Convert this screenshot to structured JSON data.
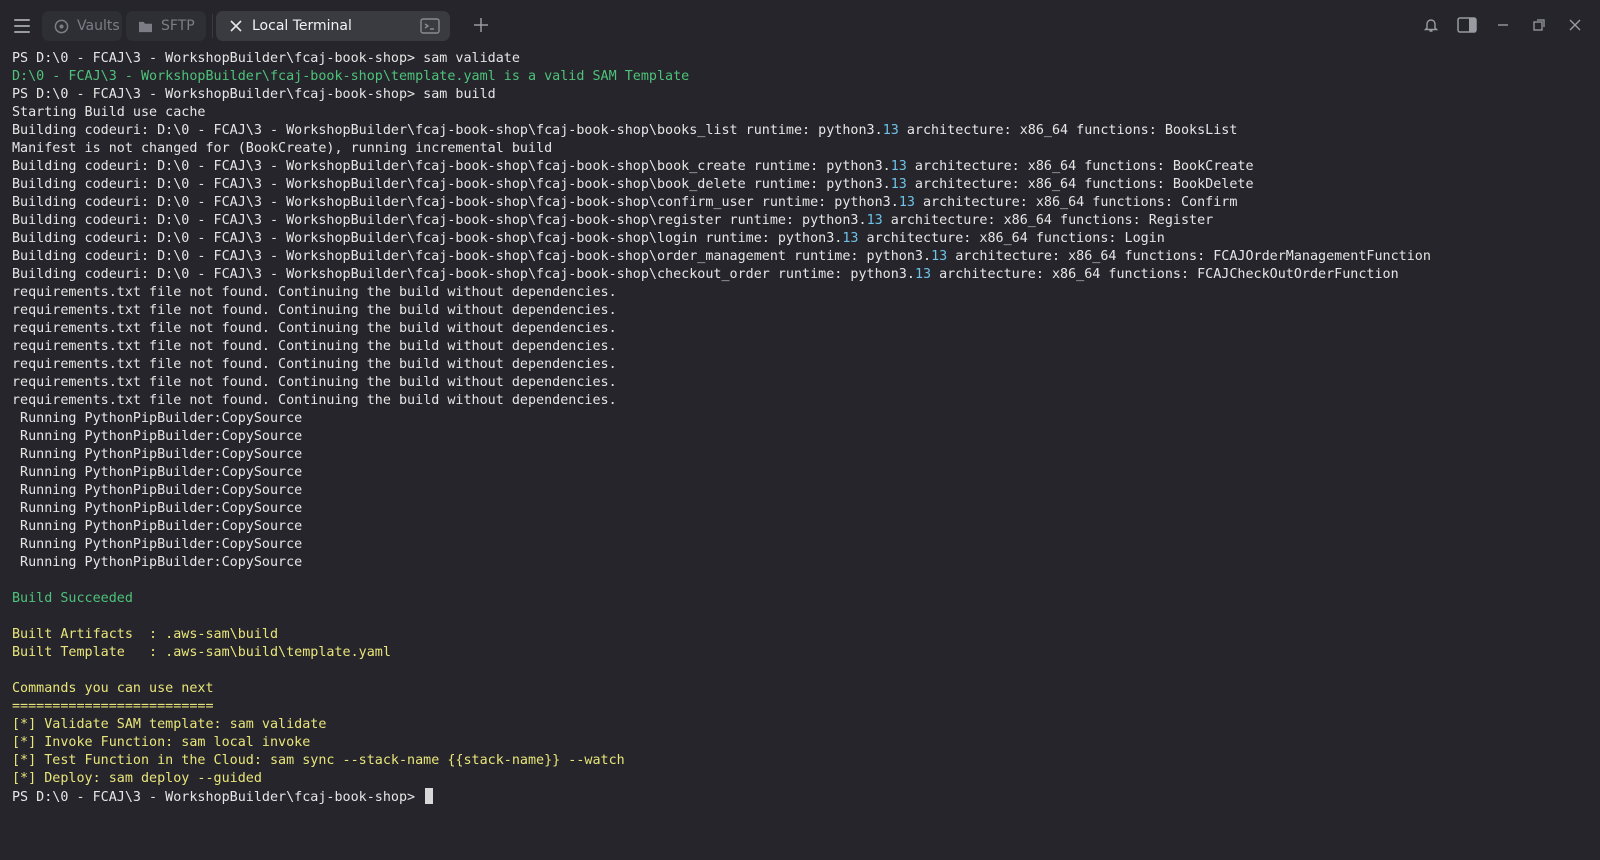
{
  "colors": {
    "background": "#25252b",
    "text": "#e6e6e6",
    "success_green": "#4ec27a",
    "hint_yellow": "#e9e57a",
    "number_blue": "#6fc2e8",
    "tab_active_bg": "#3a3a41"
  },
  "titlebar": {
    "tabs": [
      {
        "label": "Vaults",
        "icon": "vault-icon",
        "active": false
      },
      {
        "label": "SFTP",
        "icon": "folder-icon",
        "active": false
      },
      {
        "label": "Local Terminal",
        "icon": "close-icon",
        "active": true,
        "action_icon": "terminal-icon"
      }
    ],
    "new_tab_icon": "plus-icon",
    "controls": [
      "notification-bell-icon",
      "split-panel-icon",
      "minimize-icon",
      "restore-icon",
      "close-icon"
    ]
  },
  "terminal": {
    "lines": [
      [
        {
          "t": "PS D:\\0 - FCAJ\\3 - WorkshopBuilder\\fcaj-book-shop> sam validate"
        }
      ],
      [
        {
          "t": "D:\\0 - FCAJ\\3 - WorkshopBuilder\\fcaj-book-shop\\template.yaml is a valid SAM Template",
          "c": "green"
        }
      ],
      [
        {
          "t": "PS D:\\0 - FCAJ\\3 - WorkshopBuilder\\fcaj-book-shop> sam build"
        }
      ],
      [
        {
          "t": "Starting Build use cache"
        }
      ],
      [
        {
          "t": "Building codeuri: D:\\0 - FCAJ\\3 - WorkshopBuilder\\fcaj-book-shop\\fcaj-book-shop\\books_list runtime: python3."
        },
        {
          "t": "13",
          "c": "num"
        },
        {
          "t": " architecture: x86_64 functions: BooksList"
        }
      ],
      [
        {
          "t": "Manifest is not changed for (BookCreate), running incremental build"
        }
      ],
      [
        {
          "t": "Building codeuri: D:\\0 - FCAJ\\3 - WorkshopBuilder\\fcaj-book-shop\\fcaj-book-shop\\book_create runtime: python3."
        },
        {
          "t": "13",
          "c": "num"
        },
        {
          "t": " architecture: x86_64 functions: BookCreate"
        }
      ],
      [
        {
          "t": "Building codeuri: D:\\0 - FCAJ\\3 - WorkshopBuilder\\fcaj-book-shop\\fcaj-book-shop\\book_delete runtime: python3."
        },
        {
          "t": "13",
          "c": "num"
        },
        {
          "t": " architecture: x86_64 functions: BookDelete"
        }
      ],
      [
        {
          "t": "Building codeuri: D:\\0 - FCAJ\\3 - WorkshopBuilder\\fcaj-book-shop\\fcaj-book-shop\\confirm_user runtime: python3."
        },
        {
          "t": "13",
          "c": "num"
        },
        {
          "t": " architecture: x86_64 functions: Confirm"
        }
      ],
      [
        {
          "t": "Building codeuri: D:\\0 - FCAJ\\3 - WorkshopBuilder\\fcaj-book-shop\\fcaj-book-shop\\register runtime: python3."
        },
        {
          "t": "13",
          "c": "num"
        },
        {
          "t": " architecture: x86_64 functions: Register"
        }
      ],
      [
        {
          "t": "Building codeuri: D:\\0 - FCAJ\\3 - WorkshopBuilder\\fcaj-book-shop\\fcaj-book-shop\\login runtime: python3."
        },
        {
          "t": "13",
          "c": "num"
        },
        {
          "t": " architecture: x86_64 functions: Login"
        }
      ],
      [
        {
          "t": "Building codeuri: D:\\0 - FCAJ\\3 - WorkshopBuilder\\fcaj-book-shop\\fcaj-book-shop\\order_management runtime: python3."
        },
        {
          "t": "13",
          "c": "num"
        },
        {
          "t": " architecture: x86_64 functions: FCAJOrderManagementFunction"
        }
      ],
      [
        {
          "t": "Building codeuri: D:\\0 - FCAJ\\3 - WorkshopBuilder\\fcaj-book-shop\\fcaj-book-shop\\checkout_order runtime: python3."
        },
        {
          "t": "13",
          "c": "num"
        },
        {
          "t": " architecture: x86_64 functions: FCAJCheckOutOrderFunction"
        }
      ],
      [
        {
          "t": "requirements.txt file not found. Continuing the build without dependencies."
        }
      ],
      [
        {
          "t": "requirements.txt file not found. Continuing the build without dependencies."
        }
      ],
      [
        {
          "t": "requirements.txt file not found. Continuing the build without dependencies."
        }
      ],
      [
        {
          "t": "requirements.txt file not found. Continuing the build without dependencies."
        }
      ],
      [
        {
          "t": "requirements.txt file not found. Continuing the build without dependencies."
        }
      ],
      [
        {
          "t": "requirements.txt file not found. Continuing the build without dependencies."
        }
      ],
      [
        {
          "t": "requirements.txt file not found. Continuing the build without dependencies."
        }
      ],
      [
        {
          "t": " Running PythonPipBuilder:CopySource"
        }
      ],
      [
        {
          "t": " Running PythonPipBuilder:CopySource"
        }
      ],
      [
        {
          "t": " Running PythonPipBuilder:CopySource"
        }
      ],
      [
        {
          "t": " Running PythonPipBuilder:CopySource"
        }
      ],
      [
        {
          "t": " Running PythonPipBuilder:CopySource"
        }
      ],
      [
        {
          "t": " Running PythonPipBuilder:CopySource"
        }
      ],
      [
        {
          "t": " Running PythonPipBuilder:CopySource"
        }
      ],
      [
        {
          "t": " Running PythonPipBuilder:CopySource"
        }
      ],
      [
        {
          "t": " Running PythonPipBuilder:CopySource"
        }
      ],
      [
        {
          "t": ""
        }
      ],
      [
        {
          "t": "Build Succeeded",
          "c": "green"
        }
      ],
      [
        {
          "t": ""
        }
      ],
      [
        {
          "t": "Built Artifacts  : .aws-sam\\build",
          "c": "yellow"
        }
      ],
      [
        {
          "t": "Built Template   : .aws-sam\\build\\template.yaml",
          "c": "yellow"
        }
      ],
      [
        {
          "t": ""
        }
      ],
      [
        {
          "t": "Commands you can use next",
          "c": "yellow"
        }
      ],
      [
        {
          "t": "=========================",
          "c": "yellow"
        }
      ],
      [
        {
          "t": "[*] Validate SAM template: sam validate",
          "c": "yellow"
        }
      ],
      [
        {
          "t": "[*] Invoke Function: sam local invoke",
          "c": "yellow"
        }
      ],
      [
        {
          "t": "[*] Test Function in the Cloud: sam sync --stack-name {{stack-name}} --watch",
          "c": "yellow"
        }
      ],
      [
        {
          "t": "[*] Deploy: sam deploy --guided",
          "c": "yellow"
        }
      ]
    ],
    "prompt": "PS D:\\0 - FCAJ\\3 - WorkshopBuilder\\fcaj-book-shop> "
  }
}
